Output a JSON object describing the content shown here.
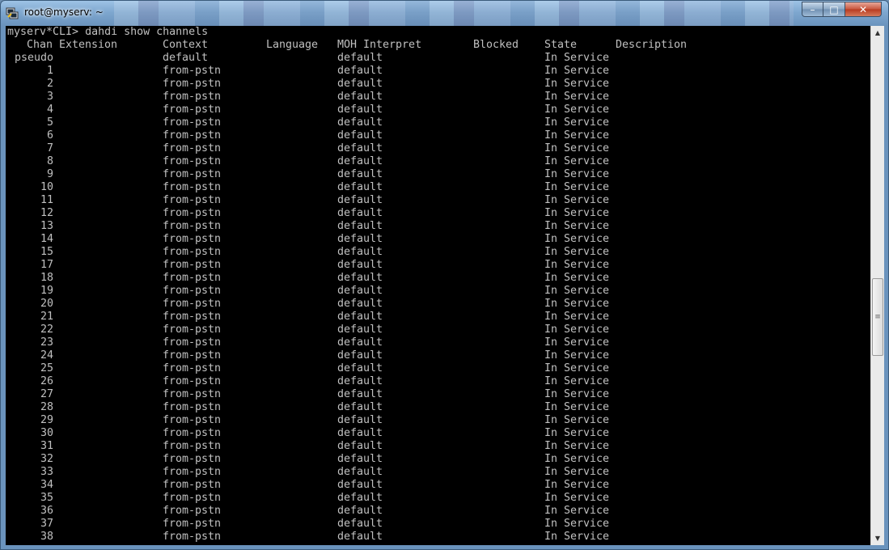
{
  "window": {
    "title": "root@myserv: ~",
    "buttons": {
      "minimize": "–",
      "maximize": "□",
      "close": "✕"
    }
  },
  "icons": {
    "app": "putty-icon",
    "scroll_up": "up-arrow-icon",
    "scroll_down": "down-arrow-icon",
    "thumb_grip": "grip-icon"
  },
  "terminal": {
    "prompt": "myserv*CLI> dahdi show channels",
    "headers": {
      "chan": "Chan",
      "extension": "Extension",
      "context": "Context",
      "language": "Language",
      "moh": "MOH Interpret",
      "blocked": "Blocked",
      "state": "State",
      "description": "Description"
    },
    "rows": [
      {
        "chan": "pseudo",
        "context": "default",
        "moh": "default",
        "state": "In Service"
      },
      {
        "chan": "1",
        "context": "from-pstn",
        "moh": "default",
        "state": "In Service"
      },
      {
        "chan": "2",
        "context": "from-pstn",
        "moh": "default",
        "state": "In Service"
      },
      {
        "chan": "3",
        "context": "from-pstn",
        "moh": "default",
        "state": "In Service"
      },
      {
        "chan": "4",
        "context": "from-pstn",
        "moh": "default",
        "state": "In Service"
      },
      {
        "chan": "5",
        "context": "from-pstn",
        "moh": "default",
        "state": "In Service"
      },
      {
        "chan": "6",
        "context": "from-pstn",
        "moh": "default",
        "state": "In Service"
      },
      {
        "chan": "7",
        "context": "from-pstn",
        "moh": "default",
        "state": "In Service"
      },
      {
        "chan": "8",
        "context": "from-pstn",
        "moh": "default",
        "state": "In Service"
      },
      {
        "chan": "9",
        "context": "from-pstn",
        "moh": "default",
        "state": "In Service"
      },
      {
        "chan": "10",
        "context": "from-pstn",
        "moh": "default",
        "state": "In Service"
      },
      {
        "chan": "11",
        "context": "from-pstn",
        "moh": "default",
        "state": "In Service"
      },
      {
        "chan": "12",
        "context": "from-pstn",
        "moh": "default",
        "state": "In Service"
      },
      {
        "chan": "13",
        "context": "from-pstn",
        "moh": "default",
        "state": "In Service"
      },
      {
        "chan": "14",
        "context": "from-pstn",
        "moh": "default",
        "state": "In Service"
      },
      {
        "chan": "15",
        "context": "from-pstn",
        "moh": "default",
        "state": "In Service"
      },
      {
        "chan": "17",
        "context": "from-pstn",
        "moh": "default",
        "state": "In Service"
      },
      {
        "chan": "18",
        "context": "from-pstn",
        "moh": "default",
        "state": "In Service"
      },
      {
        "chan": "19",
        "context": "from-pstn",
        "moh": "default",
        "state": "In Service"
      },
      {
        "chan": "20",
        "context": "from-pstn",
        "moh": "default",
        "state": "In Service"
      },
      {
        "chan": "21",
        "context": "from-pstn",
        "moh": "default",
        "state": "In Service"
      },
      {
        "chan": "22",
        "context": "from-pstn",
        "moh": "default",
        "state": "In Service"
      },
      {
        "chan": "23",
        "context": "from-pstn",
        "moh": "default",
        "state": "In Service"
      },
      {
        "chan": "24",
        "context": "from-pstn",
        "moh": "default",
        "state": "In Service"
      },
      {
        "chan": "25",
        "context": "from-pstn",
        "moh": "default",
        "state": "In Service"
      },
      {
        "chan": "26",
        "context": "from-pstn",
        "moh": "default",
        "state": "In Service"
      },
      {
        "chan": "27",
        "context": "from-pstn",
        "moh": "default",
        "state": "In Service"
      },
      {
        "chan": "28",
        "context": "from-pstn",
        "moh": "default",
        "state": "In Service"
      },
      {
        "chan": "29",
        "context": "from-pstn",
        "moh": "default",
        "state": "In Service"
      },
      {
        "chan": "30",
        "context": "from-pstn",
        "moh": "default",
        "state": "In Service"
      },
      {
        "chan": "31",
        "context": "from-pstn",
        "moh": "default",
        "state": "In Service"
      },
      {
        "chan": "32",
        "context": "from-pstn",
        "moh": "default",
        "state": "In Service"
      },
      {
        "chan": "33",
        "context": "from-pstn",
        "moh": "default",
        "state": "In Service"
      },
      {
        "chan": "34",
        "context": "from-pstn",
        "moh": "default",
        "state": "In Service"
      },
      {
        "chan": "35",
        "context": "from-pstn",
        "moh": "default",
        "state": "In Service"
      },
      {
        "chan": "36",
        "context": "from-pstn",
        "moh": "default",
        "state": "In Service"
      },
      {
        "chan": "37",
        "context": "from-pstn",
        "moh": "default",
        "state": "In Service"
      },
      {
        "chan": "38",
        "context": "from-pstn",
        "moh": "default",
        "state": "In Service"
      }
    ]
  },
  "colors": {
    "terminal_bg": "#000000",
    "terminal_fg": "#c0c0c0"
  }
}
